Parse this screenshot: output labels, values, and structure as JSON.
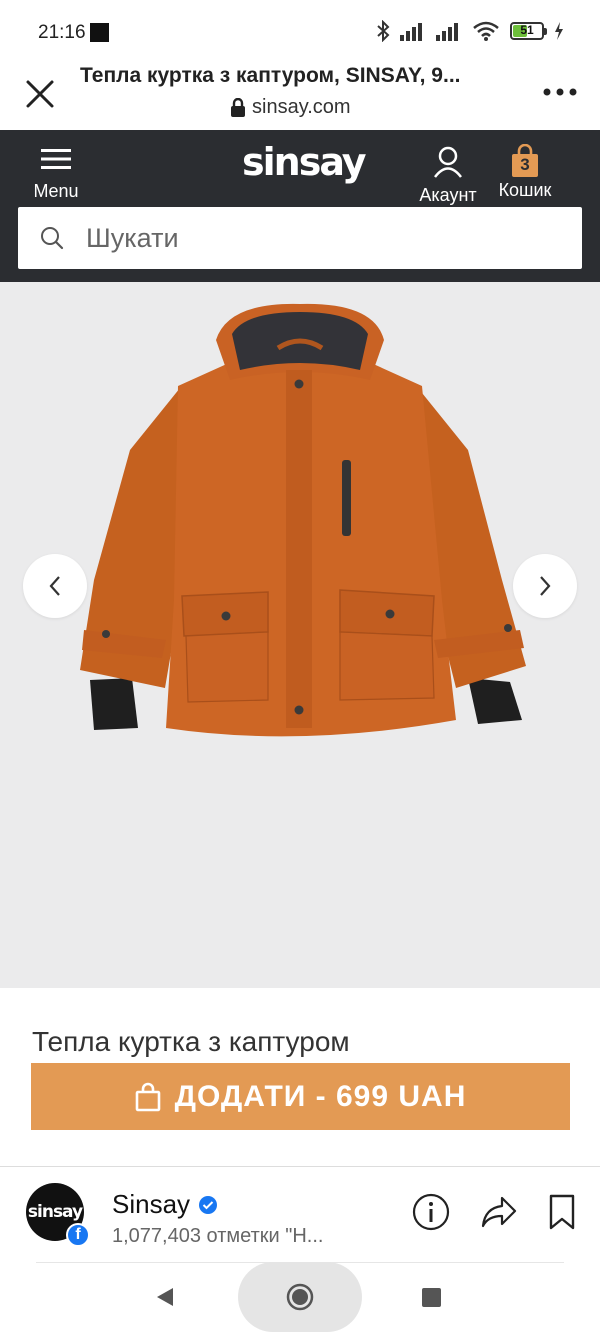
{
  "status_bar": {
    "time": "21:16",
    "battery": "51",
    "battery_fraction": 0.51
  },
  "browser": {
    "tab_title": "Тепла куртка з каптуром, SINSAY, 9...",
    "url": "sinsay.com"
  },
  "site_header": {
    "logo": "sinsay",
    "menu_label": "Menu",
    "account_label": "Акаунт",
    "cart_label": "Кошик",
    "cart_count": "3",
    "search_placeholder": "Шукати"
  },
  "gallery": {
    "product_image": "orange-hooded-jacket",
    "colors": {
      "jacket": "#c96424",
      "background": "#ebebec"
    }
  },
  "product": {
    "name": "Тепла куртка з каптуром",
    "add_button_label": "ДОДАТИ - 699 UAH"
  },
  "facebook_bar": {
    "avatar_text": "sinsay",
    "page_name": "Sinsay",
    "subtitle": "1,077,403 отметки \"Н..."
  },
  "colors": {
    "header_bg": "#2b2d31",
    "accent": "#e39a54"
  }
}
